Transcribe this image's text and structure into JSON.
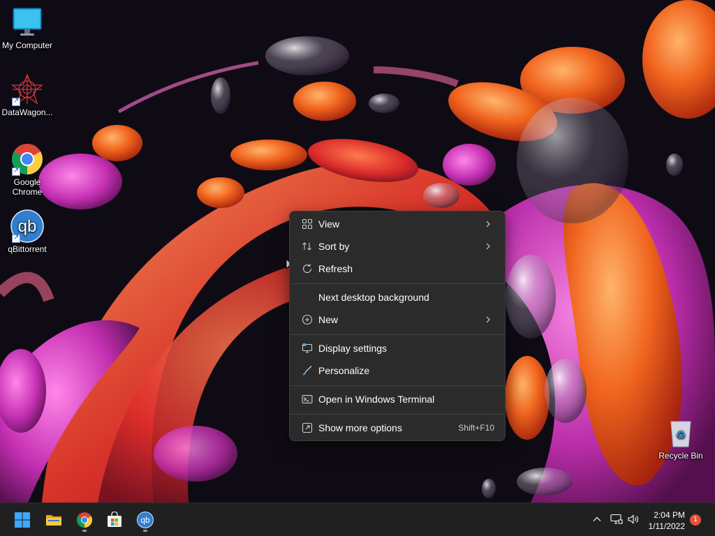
{
  "desktop": {
    "icons": [
      {
        "label": "My Computer"
      },
      {
        "label": "DataWagon..."
      },
      {
        "label": "Google Chrome"
      },
      {
        "label": "qBittorrent"
      },
      {
        "label": "Recycle Bin"
      }
    ]
  },
  "context_menu": {
    "items": [
      {
        "label": "View",
        "icon": "grid-icon",
        "submenu": true
      },
      {
        "label": "Sort by",
        "icon": "sort-arrows-icon",
        "submenu": true
      },
      {
        "label": "Refresh",
        "icon": "refresh-icon"
      },
      {
        "label": "Next desktop background"
      },
      {
        "label": "New",
        "icon": "plus-circle-icon",
        "submenu": true
      },
      {
        "label": "Display settings",
        "icon": "display-icon"
      },
      {
        "label": "Personalize",
        "icon": "brush-icon"
      },
      {
        "label": "Open in Windows Terminal",
        "icon": "terminal-icon"
      },
      {
        "label": "Show more options",
        "icon": "share-window-icon",
        "accelerator": "Shift+F10"
      }
    ]
  },
  "taskbar": {
    "apps": [
      "start-icon",
      "file-explorer-icon",
      "chrome-icon",
      "store-icon",
      "qbittorrent-icon"
    ],
    "tray": {
      "time": "2:04 PM",
      "date": "1/11/2022",
      "notification_count": "1"
    }
  },
  "colors": {
    "menu_bg": "#2b2b2b",
    "taskbar_bg": "#202020",
    "accent": "#0078d4"
  }
}
